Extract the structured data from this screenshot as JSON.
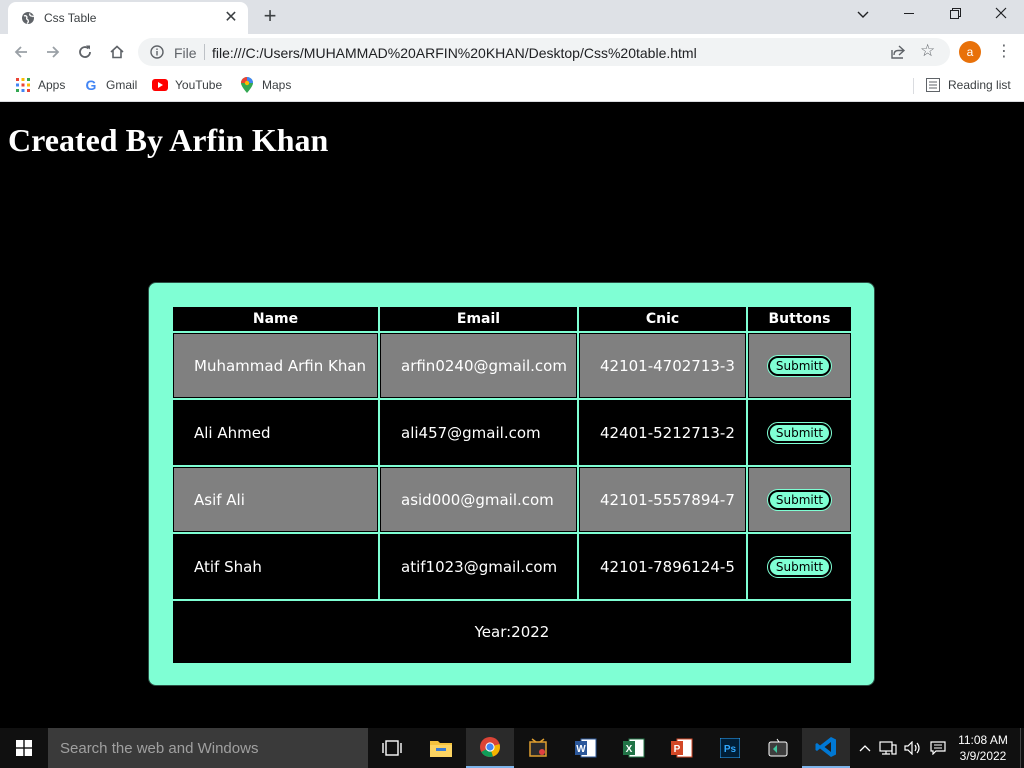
{
  "browser": {
    "tab_title": "Css Table",
    "url_scheme_label": "File",
    "url": "file:///C:/Users/MUHAMMAD%20ARFIN%20KHAN/Desktop/Css%20table.html",
    "avatar_letter": "a",
    "bookmarks": {
      "apps": "Apps",
      "gmail": "Gmail",
      "youtube": "YouTube",
      "maps": "Maps",
      "reading_list": "Reading list"
    }
  },
  "page": {
    "heading": "Created By Arfin Khan",
    "table": {
      "headers": [
        "Name",
        "Email",
        "Cnic",
        "Buttons"
      ],
      "rows": [
        {
          "name": "Muhammad Arfin Khan",
          "email": "arfin0240@gmail.com",
          "cnic": "42101-4702713-3",
          "button": "Submitt"
        },
        {
          "name": "Ali Ahmed",
          "email": "ali457@gmail.com",
          "cnic": "42401-5212713-2",
          "button": "Submitt"
        },
        {
          "name": "Asif Ali",
          "email": "asid000@gmail.com",
          "cnic": "42101-5557894-7",
          "button": "Submitt"
        },
        {
          "name": "Atif Shah",
          "email": "atif1023@gmail.com",
          "cnic": "42101-7896124-5",
          "button": "Submitt"
        }
      ],
      "footer": "Year:2022"
    },
    "colors": {
      "background": "#000000",
      "accent": "#7fffd4",
      "row_alt": "#808080"
    }
  },
  "taskbar": {
    "search_placeholder": "Search the web and Windows",
    "time": "11:08 AM",
    "date": "3/9/2022"
  }
}
